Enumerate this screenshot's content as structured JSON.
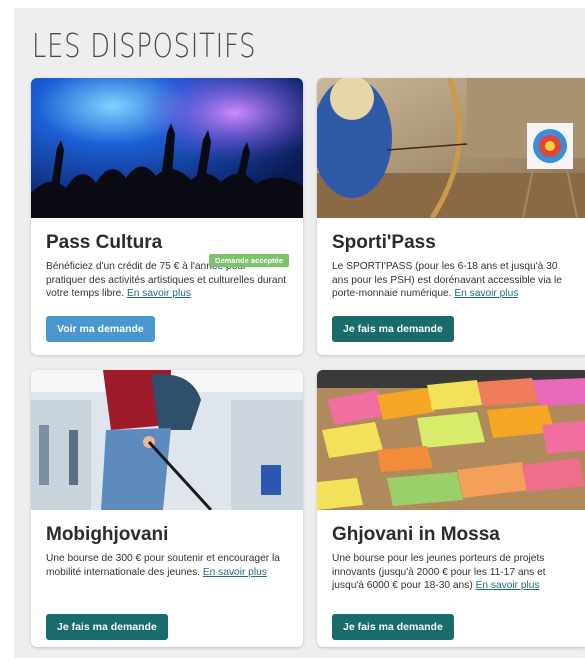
{
  "section": {
    "title": "LES DISPOSITIFS"
  },
  "cards": [
    {
      "title": "Pass Cultura",
      "badge": "Demande acceptée",
      "desc": "Bénéficiez d'un crédit de 75 € à l'année pour pratiquer des activités artistiques et culturelles durant votre temps libre.",
      "link": "En savoir plus",
      "button": "Voir ma demande",
      "image": "concert-crowd-photo"
    },
    {
      "title": "Sporti'Pass",
      "desc": "Le SPORTI'PASS (pour les 6-18 ans et jusqu'à 30 ans pour les PSH) est dorénavant accessible via le porte-monnaie numérique.",
      "link": "En savoir plus",
      "button": "Je fais ma demande",
      "image": "archery-photo"
    },
    {
      "title": "Mobighjovani",
      "desc": "Une bourse de 300 € pour soutenir et encourager la mobilité internationale des jeunes.",
      "link": "En savoir plus",
      "button": "Je fais ma demande",
      "image": "traveler-backpack-photo"
    },
    {
      "title": "Ghjovani in Mossa",
      "desc": "Une bourse pour les jeunes porteurs de projets innovants (jusqu'à 2000 € pour les 11-17 ans et jusqu'à 6000 € pour 18-30 ans)",
      "link": "En savoir plus",
      "button": "Je fais ma demande",
      "image": "sticky-notes-photo"
    }
  ],
  "colors": {
    "badge": "#7cc36b",
    "button_primary": "#4a96cf",
    "button_teal": "#1a6b6b",
    "link": "#1f6f7b"
  }
}
